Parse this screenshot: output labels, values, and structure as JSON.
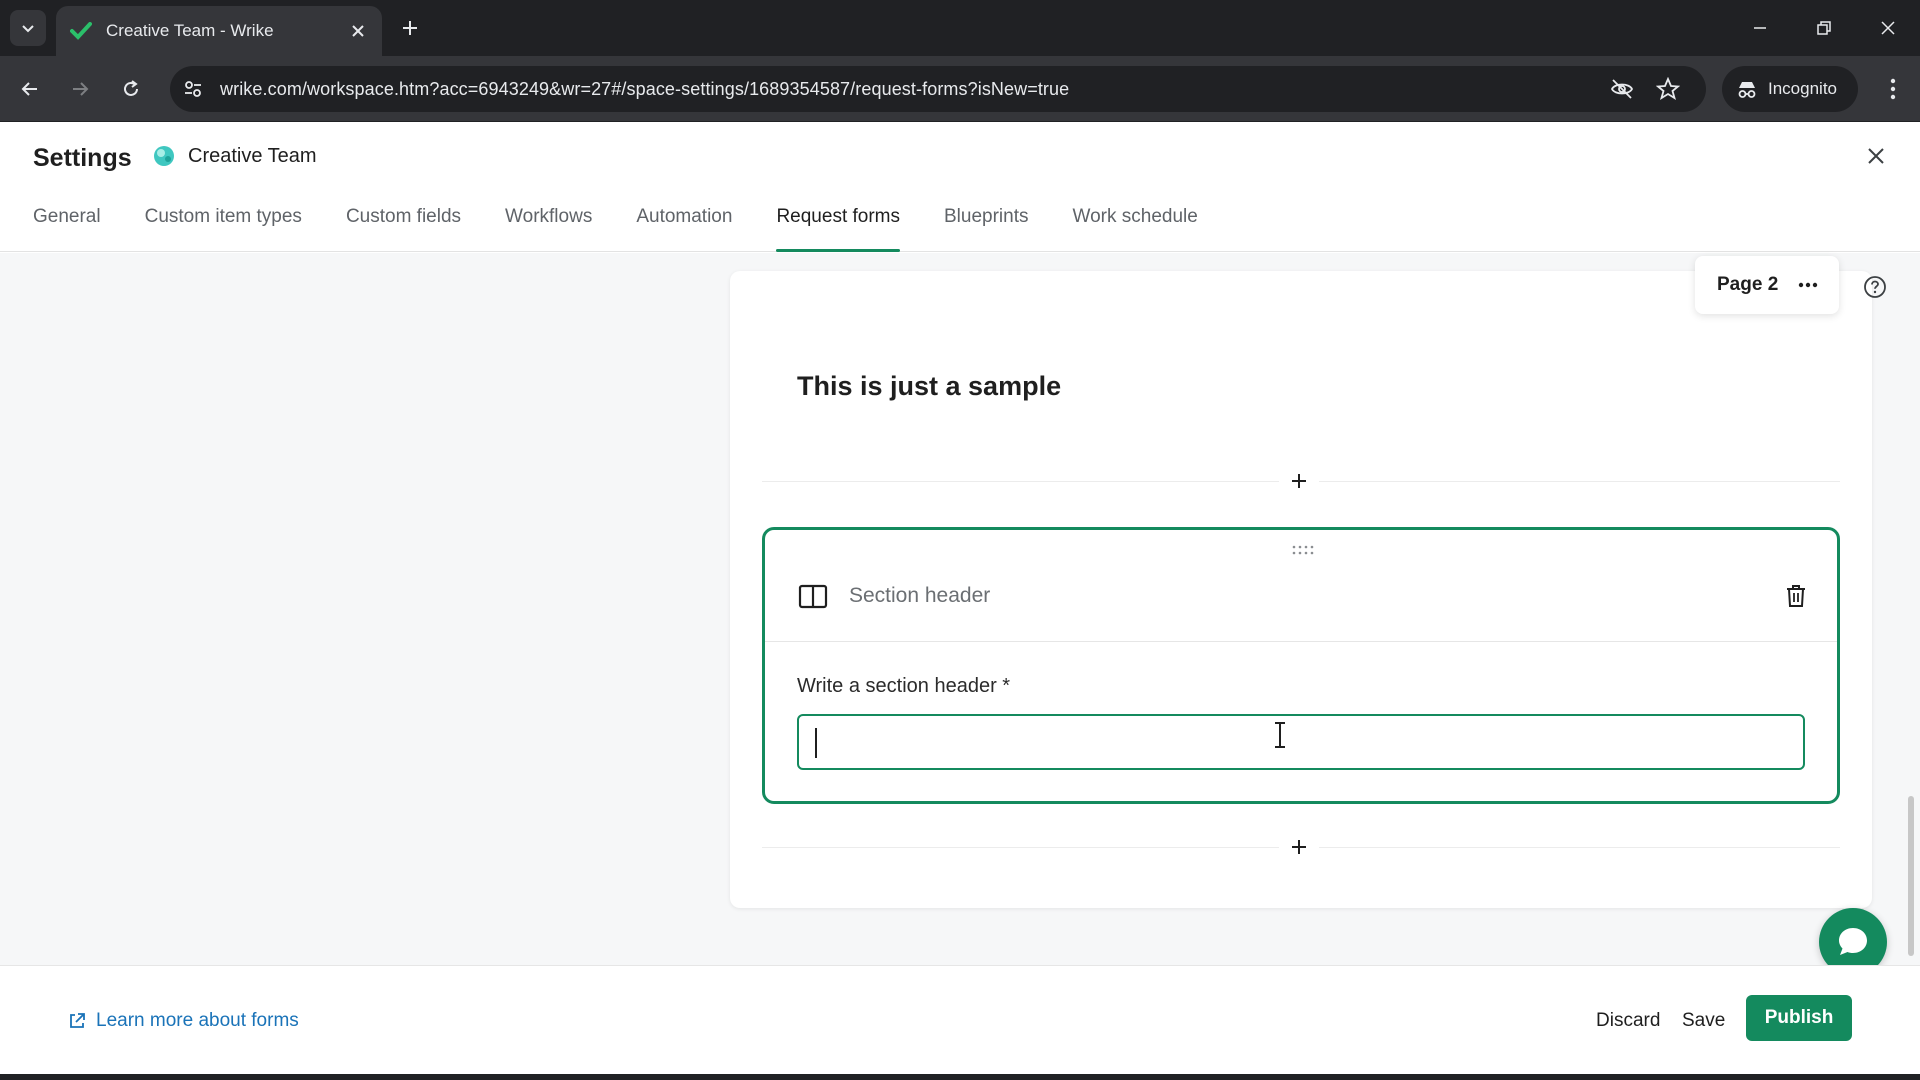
{
  "browser": {
    "tab_title": "Creative Team - Wrike",
    "url": "wrike.com/workspace.htm?acc=6943249&wr=27#/space-settings/1689354587/request-forms?isNew=true",
    "incognito_label": "Incognito"
  },
  "settings": {
    "title": "Settings",
    "space_name": "Creative Team",
    "tabs": [
      {
        "label": "General",
        "active": false
      },
      {
        "label": "Custom item types",
        "active": false
      },
      {
        "label": "Custom fields",
        "active": false
      },
      {
        "label": "Workflows",
        "active": false
      },
      {
        "label": "Automation",
        "active": false
      },
      {
        "label": "Request forms",
        "active": true
      },
      {
        "label": "Blueprints",
        "active": false
      },
      {
        "label": "Work schedule",
        "active": false
      }
    ]
  },
  "form": {
    "page_label": "Page 2",
    "title": "This is just a sample",
    "section": {
      "type_label": "Section header",
      "field_label": "Write a section header *",
      "field_value": ""
    }
  },
  "footer": {
    "learn_more": "Learn more about forms",
    "discard": "Discard",
    "save": "Save",
    "publish": "Publish"
  },
  "colors": {
    "accent": "#148a5e",
    "link": "#1a73b8",
    "chrome_dark": "#202124",
    "chrome_mid": "#35363a"
  },
  "icons": {
    "tab_favicon": "wrike-check-icon",
    "section_type": "book-open-icon",
    "delete": "trash-icon",
    "help": "question-circle-icon",
    "chat": "chat-bubble-icon",
    "external_link": "external-link-icon"
  }
}
